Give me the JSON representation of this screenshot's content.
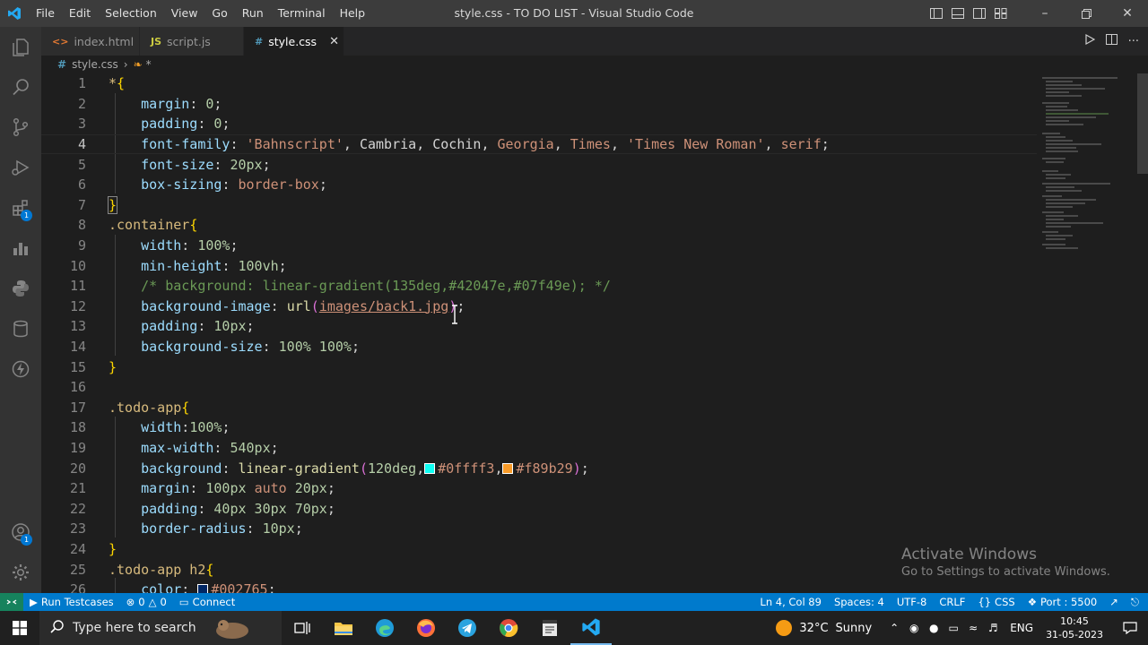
{
  "titlebar": {
    "menus": [
      "File",
      "Edit",
      "Selection",
      "View",
      "Go",
      "Run",
      "Terminal",
      "Help"
    ],
    "title": "style.css - TO DO LIST - Visual Studio Code"
  },
  "tabs": [
    {
      "label": "index.html",
      "icon": "html-file-icon",
      "active": false
    },
    {
      "label": "script.js",
      "icon": "js-file-icon",
      "active": false
    },
    {
      "label": "style.css",
      "icon": "css-file-icon",
      "active": true
    }
  ],
  "breadcrumb": {
    "file": "style.css",
    "symbol": "*"
  },
  "editor": {
    "current_line": 4,
    "lines": [
      {
        "n": "1"
      },
      {
        "n": "2"
      },
      {
        "n": "3"
      },
      {
        "n": "4"
      },
      {
        "n": "5"
      },
      {
        "n": "6"
      },
      {
        "n": "7"
      },
      {
        "n": "8"
      },
      {
        "n": "9"
      },
      {
        "n": "10"
      },
      {
        "n": "11"
      },
      {
        "n": "12"
      },
      {
        "n": "13"
      },
      {
        "n": "14"
      },
      {
        "n": "15"
      },
      {
        "n": "16"
      },
      {
        "n": "17"
      },
      {
        "n": "18"
      },
      {
        "n": "19"
      },
      {
        "n": "20"
      },
      {
        "n": "21"
      },
      {
        "n": "22"
      },
      {
        "n": "23"
      },
      {
        "n": "24"
      },
      {
        "n": "25"
      },
      {
        "n": "26"
      }
    ],
    "code": {
      "l1_sel": "*",
      "l1_open": "{",
      "l2_prop": "margin",
      "l2_val": "0",
      "l3_prop": "padding",
      "l3_val": "0",
      "l4_prop": "font-family",
      "l4_f1": "'Bahnscript'",
      "l4_f2": "Cambria",
      "l4_f3": "Cochin",
      "l4_f4": "Georgia",
      "l4_f5": "Times",
      "l4_f6": "'Times New Roman'",
      "l4_f7": "serif",
      "l5_prop": "font-size",
      "l5_val": "20px",
      "l6_prop": "box-sizing",
      "l6_val": "border-box",
      "l7_close": "}",
      "l8_sel": ".container",
      "l9_prop": "width",
      "l9_val": "100%",
      "l10_prop": "min-height",
      "l10_val": "100vh",
      "l11_comment": "/* background: linear-gradient(135deg,#42047e,#07f49e); */",
      "l12_prop": "background-image",
      "l12_fn": "url",
      "l12_arg": "images/back1.jpg",
      "l13_prop": "padding",
      "l13_val": "10px",
      "l14_prop": "background-size",
      "l14_val": "100% 100%",
      "l15_close": "}",
      "l17_sel": ".todo-app",
      "l18_prop": "width",
      "l18_val": "100%",
      "l19_prop": "max-width",
      "l19_val": "540px",
      "l20_prop": "background",
      "l20_fn": "linear-gradient",
      "l20_a1": "120deg",
      "l20_c1": "#0ffff3",
      "l20_c2": "#f89b29",
      "l21_prop": "margin",
      "l21_v1": "100px",
      "l21_v2": "auto",
      "l21_v3": "20px",
      "l22_prop": "padding",
      "l22_val": "40px 30px 70px",
      "l23_prop": "border-radius",
      "l23_val": "10px",
      "l24_close": "}",
      "l25_sel": ".todo-app h2",
      "l26_prop": "color",
      "l26_val": "#002765"
    }
  },
  "colors": {
    "swatch_cyan": "#0ffff3",
    "swatch_orange": "#f89b29",
    "swatch_navy": "#002765",
    "status_bar": "#007acc"
  },
  "watermark": {
    "line1": "Activate Windows",
    "line2": "Go to Settings to activate Windows."
  },
  "statusbar": {
    "run_testcases": "Run Testcases",
    "errors": "0",
    "warnings": "0",
    "connect": "Connect",
    "position": "Ln 4, Col 89",
    "spaces": "Spaces: 4",
    "encoding": "UTF-8",
    "eol": "CRLF",
    "language": "CSS",
    "port": "Port : 5500"
  },
  "taskbar": {
    "search_placeholder": "Type here to search",
    "weather_temp": "32°C",
    "weather_desc": "Sunny",
    "lang": "ENG",
    "time": "10:45",
    "date": "31-05-2023"
  }
}
